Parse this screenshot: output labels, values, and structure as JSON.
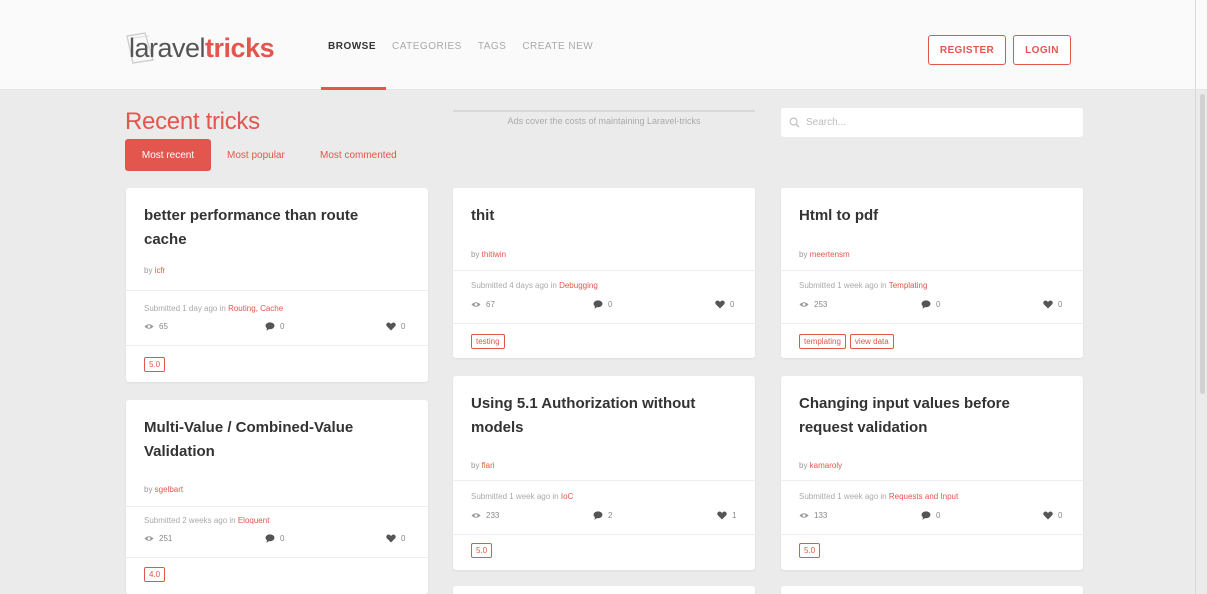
{
  "header": {
    "logo_part1": "laravel",
    "logo_part2": "tricks",
    "nav": [
      "BROWSE",
      "CATEGORIES",
      "TAGS",
      "CREATE NEW"
    ],
    "register_label": "REGISTER",
    "login_label": "LOGIN"
  },
  "section": {
    "title": "Recent tricks",
    "tabs": [
      "Most recent",
      "Most popular",
      "Most commented"
    ]
  },
  "ads": {
    "text": "Ads cover the costs of maintaining Laravel-tricks"
  },
  "search": {
    "placeholder": "Search..."
  },
  "labels": {
    "by": "by ",
    "submitted_in": " in "
  },
  "colors": {
    "accent": "#e3564e",
    "background": "#ebebeb",
    "card": "#ffffff"
  },
  "cards": [
    {
      "title": "better performance than route cache",
      "author": "icfr",
      "submitted": "Submitted 1 day ago",
      "category": "Routing, Cache",
      "views": "65",
      "comments": "0",
      "likes": "0",
      "tags": [
        "5.0"
      ]
    },
    {
      "title": "thit",
      "author": "thitiwin",
      "submitted": "Submitted 4 days ago",
      "category": "Debugging",
      "views": "67",
      "comments": "0",
      "likes": "0",
      "tags": [
        "testing"
      ]
    },
    {
      "title": "Html to pdf",
      "author": "meertensm",
      "submitted": "Submitted 1 week ago",
      "category": "Templating",
      "views": "253",
      "comments": "0",
      "likes": "0",
      "tags": [
        "templating",
        "view data"
      ]
    },
    {
      "title": "Multi-Value / Combined-Value Validation",
      "author": "sgelbart",
      "submitted": "Submitted 2 weeks ago",
      "category": "Eloquent",
      "views": "251",
      "comments": "0",
      "likes": "0",
      "tags": [
        "4.0"
      ]
    },
    {
      "title": "Using 5.1 Authorization without models",
      "author": "flari",
      "submitted": "Submitted 1 week ago",
      "category": "IoC",
      "views": "233",
      "comments": "2",
      "likes": "1",
      "tags": [
        "5.0"
      ]
    },
    {
      "title": "Changing input values before request validation",
      "author": "kamaroly",
      "submitted": "Submitted 1 week ago",
      "category": "Requests and Input",
      "views": "133",
      "comments": "0",
      "likes": "0",
      "tags": [
        "5.0"
      ]
    }
  ]
}
